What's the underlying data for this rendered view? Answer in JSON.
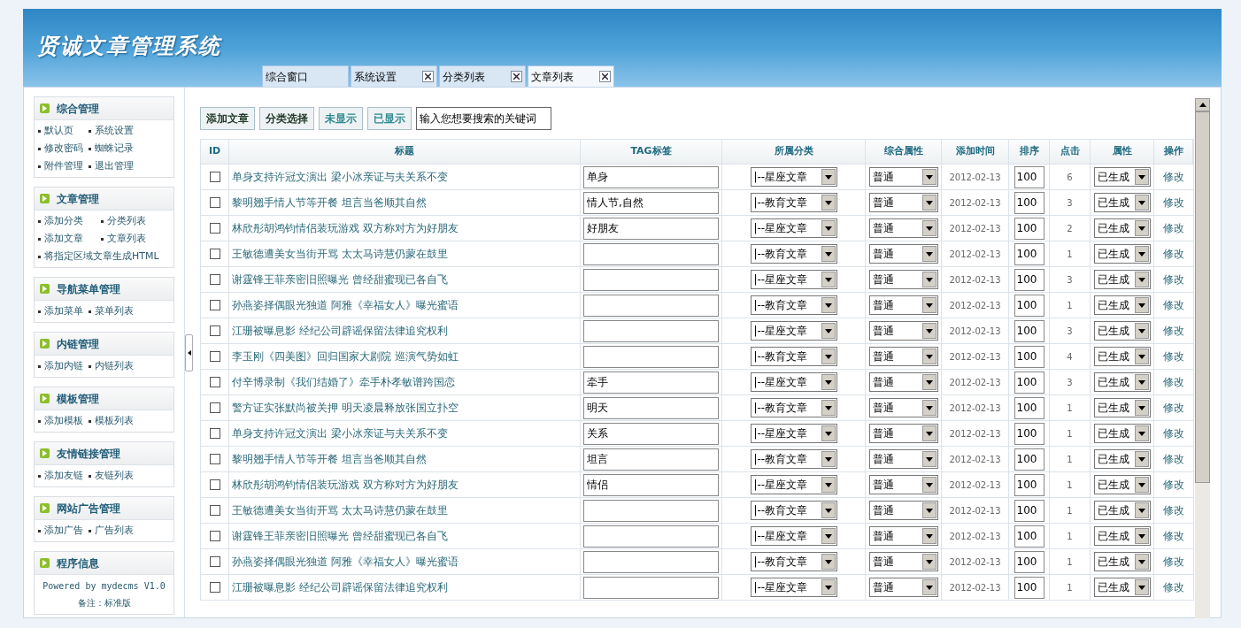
{
  "header": {
    "title": "贤诚文章管理系统"
  },
  "tabs": [
    {
      "label": "综合窗口",
      "closable": false,
      "selected": false
    },
    {
      "label": "系统设置",
      "closable": true,
      "selected": false
    },
    {
      "label": "分类列表",
      "closable": true,
      "selected": false
    },
    {
      "label": "文章列表",
      "closable": true,
      "selected": true
    }
  ],
  "sidebar": {
    "sections": [
      {
        "title": "综合管理",
        "links": [
          "默认页",
          "系统设置",
          "修改密码",
          "蜘蛛记录",
          "附件管理",
          "退出管理"
        ]
      },
      {
        "title": "文章管理",
        "links": [
          "添加分类",
          "分类列表",
          "添加文章",
          "文章列表",
          "将指定区域文章生成HTML"
        ]
      },
      {
        "title": "导航菜单管理",
        "links": [
          "添加菜单",
          "菜单列表"
        ]
      },
      {
        "title": "内链管理",
        "links": [
          "添加内链",
          "内链列表"
        ]
      },
      {
        "title": "模板管理",
        "links": [
          "添加模板",
          "模板列表"
        ]
      },
      {
        "title": "友情链接管理",
        "links": [
          "添加友链",
          "友链列表"
        ]
      },
      {
        "title": "网站广告管理",
        "links": [
          "添加广告",
          "广告列表"
        ]
      },
      {
        "title": "程序信息",
        "lines": [
          "Powered by mydecms V1.0",
          "备注：标准版"
        ]
      }
    ]
  },
  "toolbar": {
    "buttons": [
      {
        "label": "添加文章",
        "kind": "action"
      },
      {
        "label": "分类选择",
        "kind": "action"
      },
      {
        "label": "未显示",
        "kind": "filter"
      },
      {
        "label": "已显示",
        "kind": "filter"
      }
    ],
    "search": {
      "value": "输入您想要搜索的关键词"
    }
  },
  "table": {
    "columns": [
      "ID",
      "标题",
      "TAG标签",
      "所属分类",
      "综合属性",
      "添加时间",
      "排序",
      "点击",
      "属性",
      "操作"
    ],
    "rows": [
      {
        "checked": false,
        "title": "单身支持许冠文演出 梁小冰亲证与夫关系不变",
        "tag": "单身",
        "category": "|--星座文章",
        "attribute": "普通",
        "date": "2012-02-13",
        "sort": "100",
        "clicks": "6",
        "status": "已生成",
        "action": "修改"
      },
      {
        "checked": false,
        "title": "黎明翘手情人节等开餐 坦言当爸顺其自然",
        "tag": "情人节,自然",
        "category": "|--教育文章",
        "attribute": "普通",
        "date": "2012-02-13",
        "sort": "100",
        "clicks": "3",
        "status": "已生成",
        "action": "修改"
      },
      {
        "checked": false,
        "title": "林欣彤胡鸿钧情侣装玩游戏 双方称对方为好朋友",
        "tag": "好朋友",
        "category": "|--星座文章",
        "attribute": "普通",
        "date": "2012-02-13",
        "sort": "100",
        "clicks": "2",
        "status": "已生成",
        "action": "修改"
      },
      {
        "checked": false,
        "title": "王敏德遭美女当街开骂 太太马诗慧仍蒙在鼓里",
        "category": "|--教育文章",
        "attribute": "普通",
        "date": "2012-02-13",
        "sort": "100",
        "clicks": "1",
        "status": "已生成",
        "action": "修改"
      },
      {
        "checked": false,
        "title": "谢霆锋王菲亲密旧照曝光 曾经甜蜜现已各自飞",
        "category": "|--星座文章",
        "attribute": "普通",
        "date": "2012-02-13",
        "sort": "100",
        "clicks": "3",
        "status": "已生成",
        "action": "修改"
      },
      {
        "checked": false,
        "title": "孙燕姿择偶眼光独道 阿雅《幸福女人》曝光蜜语",
        "category": "|--教育文章",
        "attribute": "普通",
        "date": "2012-02-13",
        "sort": "100",
        "clicks": "1",
        "status": "已生成",
        "action": "修改"
      },
      {
        "checked": false,
        "title": "江珊被曝息影 经纪公司辟谣保留法律追究权利",
        "category": "|--星座文章",
        "attribute": "普通",
        "date": "2012-02-13",
        "sort": "100",
        "clicks": "3",
        "status": "已生成",
        "action": "修改"
      },
      {
        "checked": false,
        "title": "李玉刚《四美图》回归国家大剧院 巡演气势如虹",
        "category": "|--教育文章",
        "attribute": "普通",
        "date": "2012-02-13",
        "sort": "100",
        "clicks": "4",
        "status": "已生成",
        "action": "修改"
      },
      {
        "checked": false,
        "title": "付辛博录制《我们结婚了》牵手朴孝敏谱跨国恋",
        "tag": "牵手",
        "category": "|--星座文章",
        "attribute": "普通",
        "date": "2012-02-13",
        "sort": "100",
        "clicks": "3",
        "status": "已生成",
        "action": "修改"
      },
      {
        "checked": false,
        "title": "警方证实张默尚被关押 明天凌晨释放张国立扑空",
        "tag": "明天",
        "category": "|--教育文章",
        "attribute": "普通",
        "date": "2012-02-13",
        "sort": "100",
        "clicks": "1",
        "status": "已生成",
        "action": "修改"
      },
      {
        "checked": false,
        "title": "单身支持许冠文演出 梁小冰亲证与夫关系不变",
        "tag": "关系",
        "category": "|--星座文章",
        "attribute": "普通",
        "date": "2012-02-13",
        "sort": "100",
        "clicks": "1",
        "status": "已生成",
        "action": "修改"
      },
      {
        "checked": false,
        "title": "黎明翘手情人节等开餐 坦言当爸顺其自然",
        "tag": "坦言",
        "category": "|--教育文章",
        "attribute": "普通",
        "date": "2012-02-13",
        "sort": "100",
        "clicks": "1",
        "status": "已生成",
        "action": "修改"
      },
      {
        "checked": false,
        "title": "林欣彤胡鸿钧情侣装玩游戏 双方称对方为好朋友",
        "tag": "情侣",
        "category": "|--星座文章",
        "attribute": "普通",
        "date": "2012-02-13",
        "sort": "100",
        "clicks": "1",
        "status": "已生成",
        "action": "修改"
      },
      {
        "checked": false,
        "title": "王敏德遭美女当街开骂 太太马诗慧仍蒙在鼓里",
        "category": "|--教育文章",
        "attribute": "普通",
        "date": "2012-02-13",
        "sort": "100",
        "clicks": "1",
        "status": "已生成",
        "action": "修改"
      },
      {
        "checked": false,
        "title": "谢霆锋王菲亲密旧照曝光 曾经甜蜜现已各自飞",
        "category": "|--星座文章",
        "attribute": "普通",
        "date": "2012-02-13",
        "sort": "100",
        "clicks": "1",
        "status": "已生成",
        "action": "修改"
      },
      {
        "checked": false,
        "title": "孙燕姿择偶眼光独道 阿雅《幸福女人》曝光蜜语",
        "category": "|--教育文章",
        "attribute": "普通",
        "date": "2012-02-13",
        "sort": "100",
        "clicks": "1",
        "status": "已生成",
        "action": "修改"
      },
      {
        "checked": false,
        "title": "江珊被曝息影 经纪公司辟谣保留法律追究权利",
        "category": "|--星座文章",
        "attribute": "普通",
        "date": "2012-02-13",
        "sort": "100",
        "clicks": "1",
        "status": "已生成",
        "action": "修改"
      }
    ]
  }
}
